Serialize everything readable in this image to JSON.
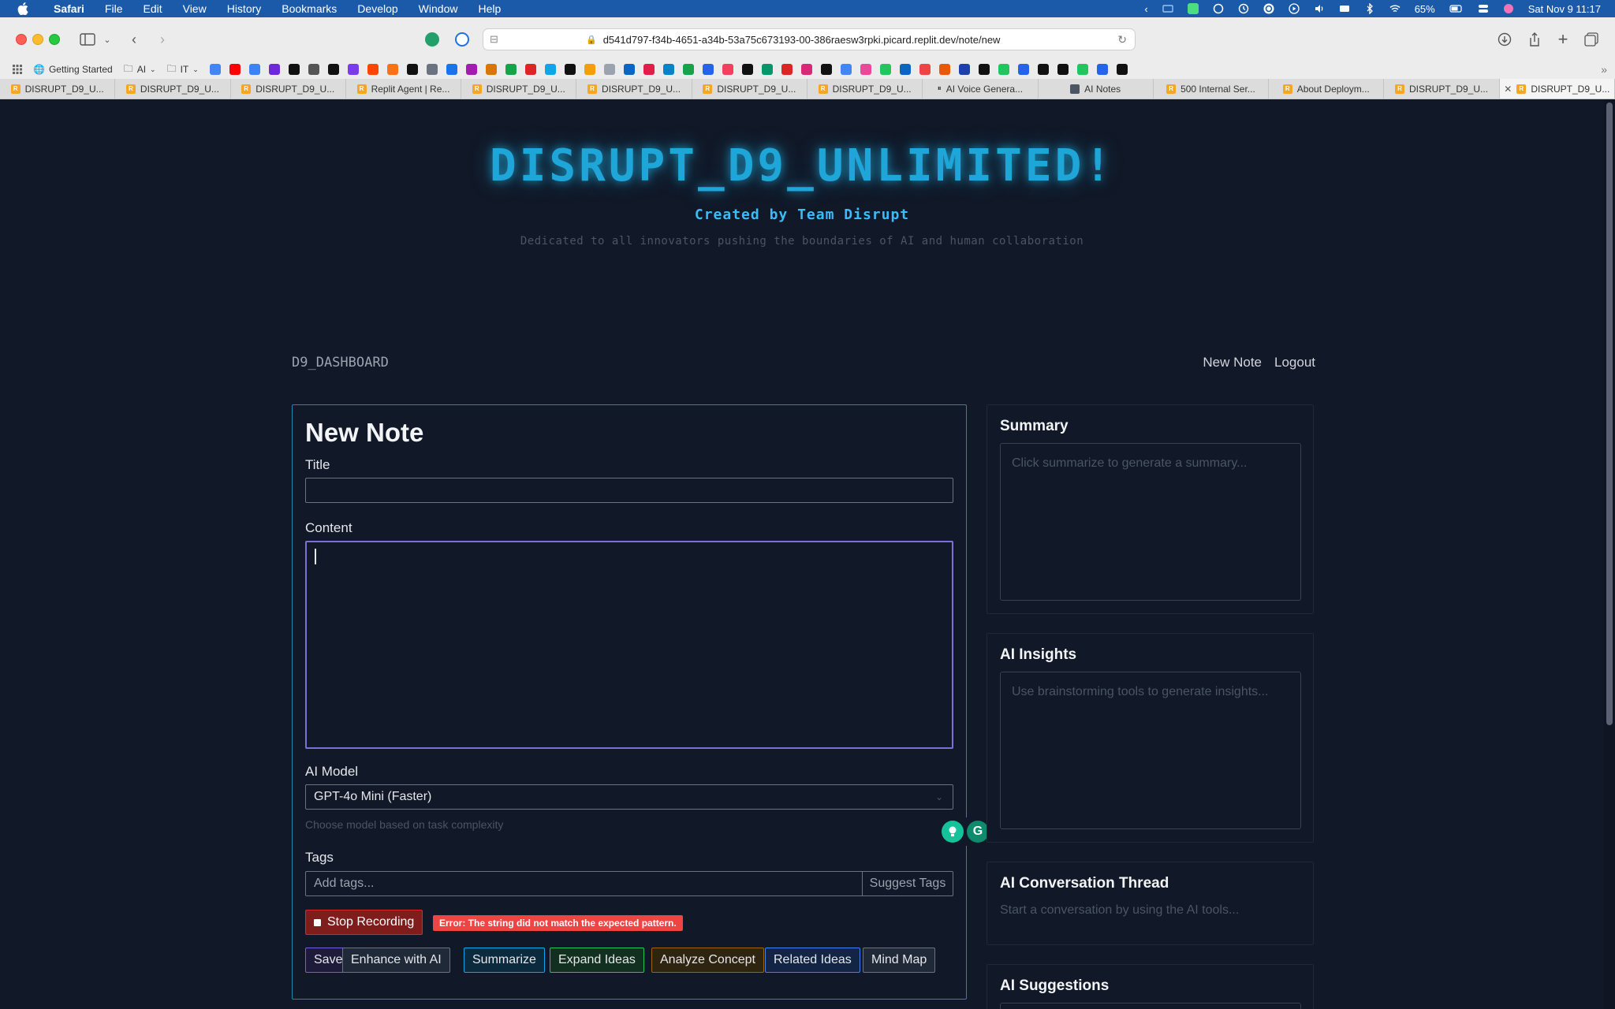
{
  "menubar": {
    "app": "Safari",
    "items": [
      "File",
      "Edit",
      "View",
      "History",
      "Bookmarks",
      "Develop",
      "Window",
      "Help"
    ],
    "battery": "65%",
    "datetime": "Sat Nov 9  11:17"
  },
  "browser": {
    "url": "d541d797-f34b-4651-a34b-53a75c673193-00-386raesw3rpki.picard.replit.dev/note/new",
    "favorites": [
      {
        "label": "Getting Started",
        "icon": "globe-icon"
      },
      {
        "label": "AI",
        "icon": "folder-icon"
      },
      {
        "label": "IT",
        "icon": "folder-icon"
      }
    ],
    "fav_icon_colors": [
      "#4285f4",
      "#ff0000",
      "#3b82f6",
      "#6d28d9",
      "#111111",
      "#555555",
      "#111111",
      "#7c3aed",
      "#ff4500",
      "#f97316",
      "#111111",
      "#6b7280",
      "#1a73e8",
      "#a21caf",
      "#d97706",
      "#16a34a",
      "#dc2626",
      "#0ea5e9",
      "#111111",
      "#f59e0b",
      "#9ca3af",
      "#0a66c2",
      "#e11d48",
      "#0284c7",
      "#16a34a",
      "#2563eb",
      "#f43f5e",
      "#111111",
      "#059669",
      "#dc2626",
      "#db2777",
      "#111111",
      "#4285f4",
      "#ec4899",
      "#22c55e",
      "#0a66c2",
      "#ef4444",
      "#ea580c",
      "#1e40af",
      "#111111",
      "#22c55e",
      "#2563eb",
      "#111111",
      "#111111",
      "#22c55e",
      "#2563eb",
      "#111111"
    ],
    "tabs": [
      {
        "label": "DISRUPT_D9_U...",
        "active": false
      },
      {
        "label": "DISRUPT_D9_U...",
        "active": false
      },
      {
        "label": "DISRUPT_D9_U...",
        "active": false
      },
      {
        "label": "Replit Agent | Re...",
        "active": false
      },
      {
        "label": "DISRUPT_D9_U...",
        "active": false
      },
      {
        "label": "DISRUPT_D9_U...",
        "active": false
      },
      {
        "label": "DISRUPT_D9_U...",
        "active": false
      },
      {
        "label": "DISRUPT_D9_U...",
        "active": false
      },
      {
        "label": "AI Voice Genera...",
        "active": false
      },
      {
        "label": "AI Notes",
        "active": false
      },
      {
        "label": "500 Internal Ser...",
        "active": false
      },
      {
        "label": "About Deploym...",
        "active": false
      },
      {
        "label": "DISRUPT_D9_U...",
        "active": false
      },
      {
        "label": "DISRUPT_D9_U...",
        "active": true
      }
    ]
  },
  "hero": {
    "title": "DISRUPT_D9_UNLIMITED!",
    "subtitle": "Created by Team Disrupt",
    "dedication": "Dedicated to all innovators pushing the boundaries of AI and human collaboration"
  },
  "nav": {
    "brand": "D9_DASHBOARD",
    "new_note": "New Note",
    "logout": "Logout"
  },
  "editor": {
    "heading": "New Note",
    "title_label": "Title",
    "title_value": "",
    "content_label": "Content",
    "content_value": "",
    "model_label": "AI Model",
    "model_value": "GPT-4o Mini (Faster)",
    "model_help": "Choose model based on task complexity",
    "tags_label": "Tags",
    "tags_placeholder": "Add tags...",
    "suggest_tags": "Suggest Tags",
    "stop_recording": "Stop Recording",
    "error": "Error: The string did not match the expected pattern.",
    "actions": {
      "save": "Save",
      "enhance": "Enhance with AI",
      "summarize": "Summarize",
      "expand": "Expand Ideas",
      "analyze": "Analyze Concept",
      "related": "Related Ideas",
      "mindmap": "Mind Map"
    }
  },
  "sidebar": {
    "summary": {
      "title": "Summary",
      "placeholder": "Click summarize to generate a summary..."
    },
    "insights": {
      "title": "AI Insights",
      "placeholder": "Use brainstorming tools to generate insights..."
    },
    "thread": {
      "title": "AI Conversation Thread",
      "placeholder": "Start a conversation by using the AI tools..."
    },
    "suggestions": {
      "title": "AI Suggestions"
    }
  },
  "colors": {
    "page_bg": "#111827",
    "accent_cyan": "#1fa6d8",
    "menubar_blue": "#1b5aa8",
    "error_red": "#ef4444"
  }
}
